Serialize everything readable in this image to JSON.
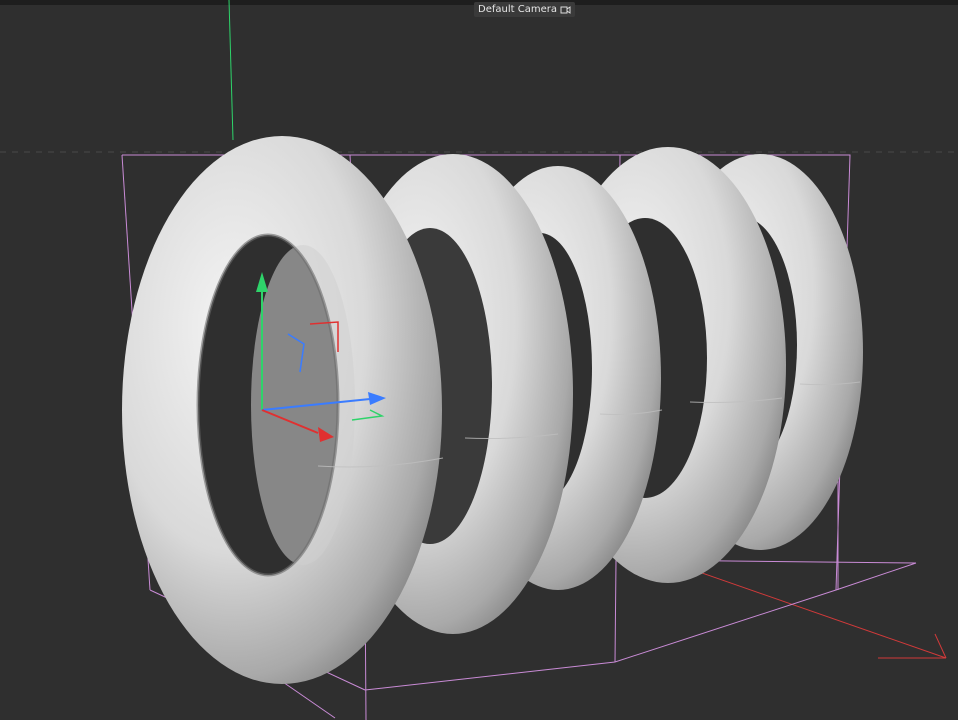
{
  "viewport": {
    "camera_label": "Default Camera",
    "camera_icon": "camera-link-icon",
    "colors": {
      "background": "#2f2f2f",
      "y_axis": "#2ed36a",
      "x_axis": "#e03030",
      "z_axis": "#3a7cff",
      "bounding_box": "#c98bd6",
      "torus_light": "#f2f2f2",
      "torus_shadow": "#7a7a7a"
    }
  }
}
